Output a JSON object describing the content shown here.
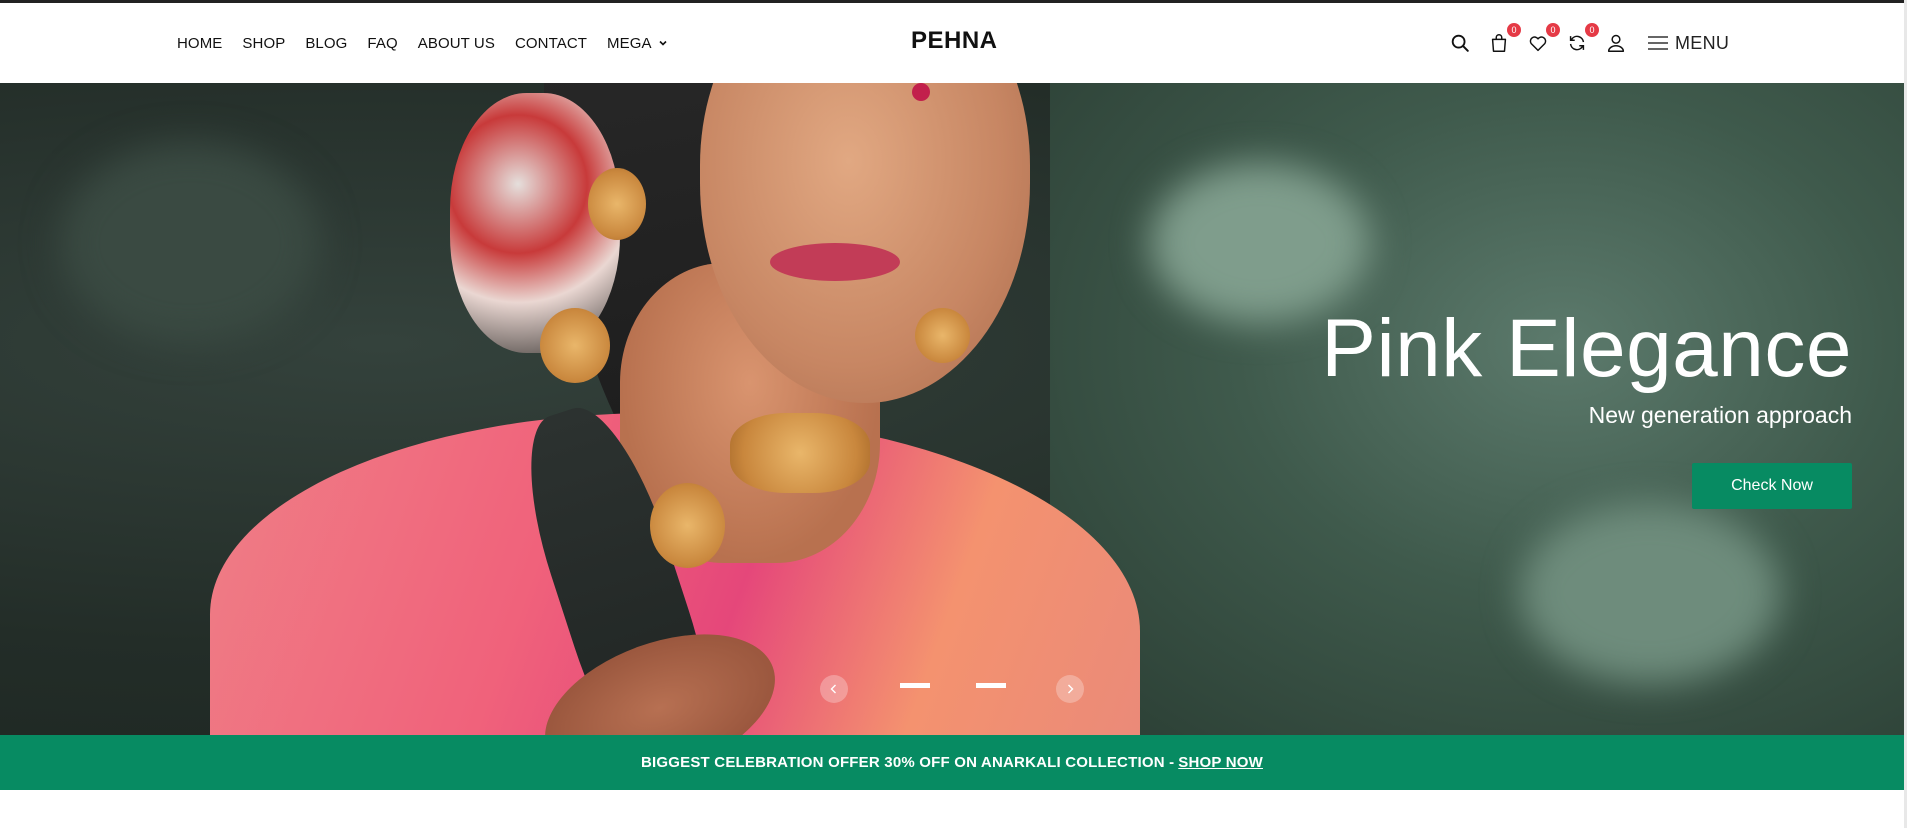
{
  "header": {
    "nav": [
      {
        "label": "HOME"
      },
      {
        "label": "SHOP"
      },
      {
        "label": "BLOG"
      },
      {
        "label": "FAQ"
      },
      {
        "label": "ABOUT US"
      },
      {
        "label": "CONTACT"
      },
      {
        "label": "MEGA"
      }
    ],
    "logo": "PEHNA",
    "icons": {
      "cart_count": "0",
      "wishlist_count": "0",
      "compare_count": "0"
    },
    "menu_label": "MENU"
  },
  "hero": {
    "title": "Pink Elegance",
    "subtitle": "New generation approach",
    "button_label": "Check Now",
    "slides_count": 2,
    "active_slide": 1
  },
  "promo": {
    "text": "BIGGEST CELEBRATION OFFER 30% OFF ON ANARKALI COLLECTION -",
    "link_label": "SHOP NOW"
  },
  "colors": {
    "accent": "#078b62",
    "badge": "#e53a46"
  }
}
